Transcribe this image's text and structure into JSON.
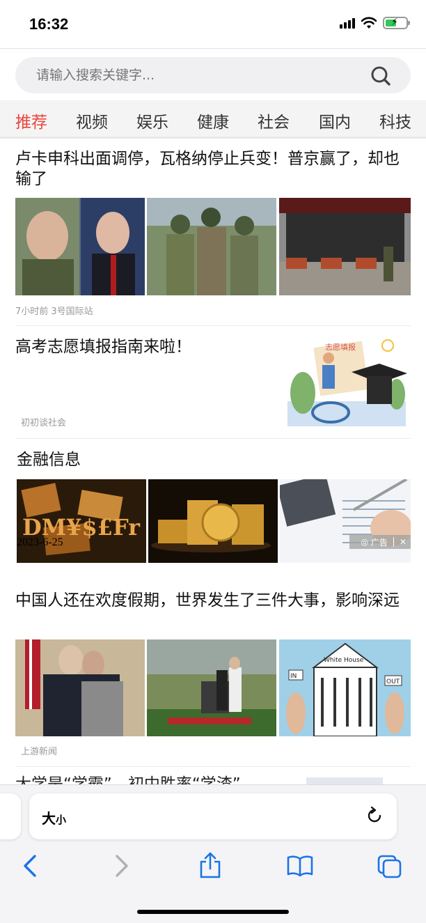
{
  "status": {
    "time": "16:32"
  },
  "search": {
    "placeholder": "请输入搜索关键字..."
  },
  "tabs": [
    {
      "label": "推荐",
      "active": true
    },
    {
      "label": "视频"
    },
    {
      "label": "娱乐"
    },
    {
      "label": "健康"
    },
    {
      "label": "社会"
    },
    {
      "label": "国内"
    },
    {
      "label": "科技"
    }
  ],
  "articles": [
    {
      "title": "卢卡申科出面调停，瓦格纳停止兵变！普京赢了，却也输了",
      "meta": "7小时前  3号国际站"
    },
    {
      "title": "高考志愿填报指南来啦！",
      "source": "初初谈社会",
      "thumb_text": "志愿填报"
    },
    {
      "title": "金融信息",
      "date": "2023-6-25",
      "ad_label": "广告",
      "ad_close": "✕",
      "ad_tile_text": "DM¥$£Fr"
    },
    {
      "title": "中国人还在欢度假期，世界发生了三件大事，影响深远",
      "source": "上游新闻",
      "tile_text": "White House",
      "sign_left": "IN",
      "sign_right": "OUT"
    },
    {
      "title_partial": "大学是“学霸”，初中胜率“学渣”"
    }
  ],
  "toolbar": {
    "aa_big": "大",
    "aa_small": "小"
  },
  "colors": {
    "accent": "#e8463b",
    "ios_blue": "#1a73e8",
    "disabled": "#b0b0b0"
  }
}
